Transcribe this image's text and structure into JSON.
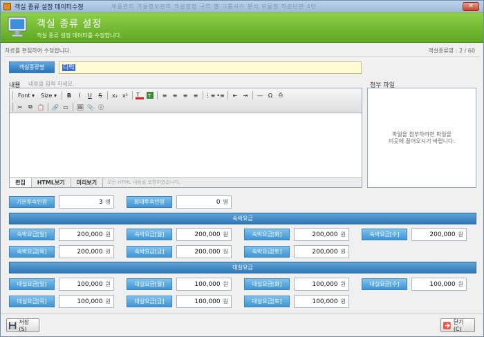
{
  "window": {
    "title": "객실 종류 설정 데이터수정",
    "ghost_menu": "제품관리  가용정보관리  객실설정  구역 별 그룹시스  분석  모듈철  직원단관 4단"
  },
  "header": {
    "title": "객실 종류 설정",
    "subtitle": "객실 종류 설정 데이타를 수정합니다."
  },
  "status": {
    "left": "자료를 편집하여 수정합니다.",
    "right": "객실종류명 : 2 / 60"
  },
  "name_field": {
    "label": "객실종류명",
    "value": "디럭"
  },
  "content": {
    "label": "내용",
    "hint": "내용을 입력 하세요."
  },
  "attachment": {
    "label": "첨부 파일",
    "hint_line1": "파일을 첨부하려면 파일을",
    "hint_line2": "이곳에 끌어오시기 바랍니다."
  },
  "toolbar": {
    "font_label": "Font",
    "size_label": "Size",
    "bold": "B",
    "italic": "I",
    "underline": "U",
    "strike": "̶S",
    "subscript": "x₂",
    "superscript": "x²",
    "omega": "Ω"
  },
  "editor_tabs": [
    {
      "label": "편집"
    },
    {
      "label": "HTML보기"
    },
    {
      "label": "미리보기"
    }
  ],
  "editor_tab_hint": "모든 HTML 내용을 포함하였습니다.",
  "occupancy": {
    "base_label": "기본투숙인원",
    "base_value": "3",
    "base_unit": "명",
    "max_label": "최대투숙인원",
    "max_value": "0",
    "max_unit": "명"
  },
  "stay": {
    "section": "숙박요금",
    "unit": "원",
    "rates": [
      {
        "label": "숙박요금[일]",
        "value": "200,000"
      },
      {
        "label": "숙박요금[월]",
        "value": "200,000"
      },
      {
        "label": "숙박요금[화]",
        "value": "200,000"
      },
      {
        "label": "숙박요금[수]",
        "value": "200,000"
      },
      {
        "label": "숙박요금[목]",
        "value": "200,000"
      },
      {
        "label": "숙박요금[금]",
        "value": "200,000"
      },
      {
        "label": "숙박요금[토]",
        "value": "200,000"
      }
    ]
  },
  "rental": {
    "section": "대실요금",
    "unit": "원",
    "rates": [
      {
        "label": "대실요금[일]",
        "value": "100,000"
      },
      {
        "label": "대실요금[월]",
        "value": "100,000"
      },
      {
        "label": "대실요금[화]",
        "value": "100,000"
      },
      {
        "label": "대실요금[수]",
        "value": "100,000"
      },
      {
        "label": "대실요금[목]",
        "value": "100,000"
      },
      {
        "label": "대실요금[금]",
        "value": "100,000"
      },
      {
        "label": "대실요금[토]",
        "value": "100,000"
      }
    ]
  },
  "buttons": {
    "save": "저장(S)",
    "close": "닫기(C)"
  },
  "colors": {
    "header_green": "#6fb62e",
    "label_blue": "#3f94d3",
    "band_blue": "#2f79b8",
    "name_bg": "#fffbd5"
  }
}
